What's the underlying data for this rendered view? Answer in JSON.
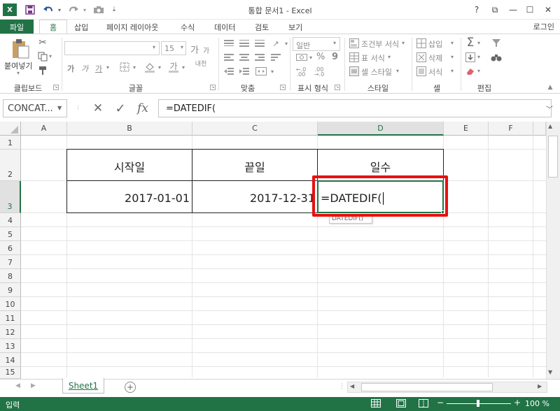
{
  "titlebar": {
    "logo": "X",
    "title": "통합 문서1 - Excel",
    "quick_access": [
      "save-icon",
      "undo-icon",
      "redo-icon",
      "camera-icon"
    ],
    "controls": {
      "help": "?",
      "restore_ribbon": "⧉",
      "minimize": "—",
      "maximize": "☐",
      "close": "✕"
    }
  },
  "tabs": {
    "file": "파일",
    "items": [
      "홈",
      "삽입",
      "페이지 레이아웃",
      "수식",
      "데이터",
      "검토",
      "보기"
    ],
    "active": "홈",
    "login": "로그인"
  },
  "ribbon": {
    "clipboard": {
      "label": "클립보드",
      "paste": "붙여넣기"
    },
    "font": {
      "label": "글꼴",
      "font_size": "15",
      "bold": "가",
      "italic": "가",
      "underline": "가",
      "grow": "가",
      "shrink": "가",
      "phonetic": "내천"
    },
    "alignment": {
      "label": "맞춤"
    },
    "number": {
      "label": "표시 형식",
      "format": "일반",
      "percent": "%",
      "comma": "9"
    },
    "styles": {
      "label": "스타일",
      "conditional": "조건부 서식",
      "table": "표 서식",
      "cell_style": "셀 스타일"
    },
    "cells": {
      "label": "셀",
      "insert": "삽입",
      "delete": "삭제",
      "format": "서식"
    },
    "editing": {
      "label": "편집"
    }
  },
  "formula_bar": {
    "name_box": "CONCAT...",
    "cancel": "✕",
    "enter": "✓",
    "fx": "fx",
    "value": "=DATEDIF("
  },
  "sheet": {
    "columns": [
      "A",
      "B",
      "C",
      "D",
      "E",
      "F"
    ],
    "selected_column": "D",
    "rows": [
      "1",
      "2",
      "3",
      "4",
      "5",
      "6",
      "7",
      "8",
      "9",
      "10",
      "11",
      "12",
      "13",
      "14",
      "15"
    ],
    "selected_row": "3",
    "cells": {
      "B2": "시작일",
      "C2": "끝일",
      "D2": "일수",
      "B3": "2017-01-01",
      "C3": "2017-12-31",
      "D3": "=DATEDIF("
    },
    "tooltip": "DATEDIF()",
    "highlight_color": "#e81010"
  },
  "sheet_tabs": {
    "tabs": [
      "Sheet1"
    ],
    "active": "Sheet1",
    "add": "+"
  },
  "status": {
    "mode": "입력",
    "zoom": "100 %",
    "zoom_out": "−",
    "zoom_in": "+"
  },
  "colors": {
    "accent": "#217346"
  }
}
